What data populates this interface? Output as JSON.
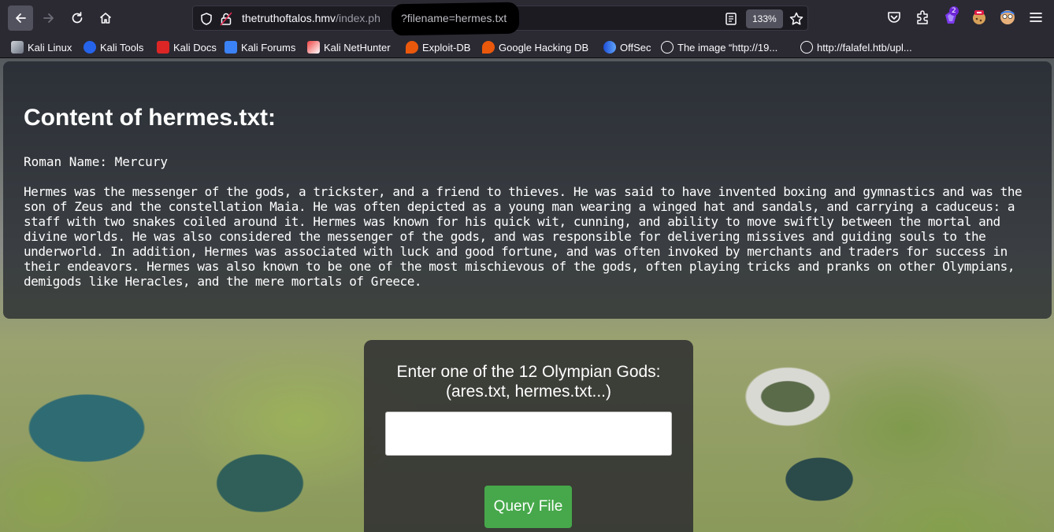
{
  "browser": {
    "url_host": "thetruthoftalos.hmv",
    "url_path": "/index.ph",
    "url_param": "?filename=hermes.txt",
    "zoom": "133%",
    "ext_badge_count": "2"
  },
  "bookmarks": [
    {
      "label": "Kali Linux",
      "icon": "kali-dragon-icon"
    },
    {
      "label": "Kali Tools",
      "icon": "kali-tools-icon"
    },
    {
      "label": "Kali Docs",
      "icon": "kali-docs-icon"
    },
    {
      "label": "Kali Forums",
      "icon": "kali-forums-icon"
    },
    {
      "label": "Kali NetHunter",
      "icon": "nethunter-icon"
    },
    {
      "label": "Exploit-DB",
      "icon": "exploit-db-icon"
    },
    {
      "label": "Google Hacking DB",
      "icon": "ghdb-icon"
    },
    {
      "label": "OffSec",
      "icon": "offsec-icon"
    },
    {
      "label": "The image “http://19...",
      "icon": "globe-icon"
    },
    {
      "label": "http://falafel.htb/upl...",
      "icon": "globe-icon"
    }
  ],
  "content": {
    "title": "Content of hermes.txt:",
    "roman_name": "Roman Name: Mercury",
    "body": "Hermes was the messenger of the gods, a trickster, and a friend to thieves. He was said to have invented boxing and gymnastics and was the son of Zeus and the constellation Maia. He was often depicted as a young man wearing a winged hat and sandals, and carrying a caduceus: a staff with two snakes coiled around it. Hermes was known for his quick wit, cunning, and ability to move swiftly between the mortal and divine worlds. He was also considered the messenger of the gods, and was responsible for delivering missives and guiding souls to the underworld. In addition, Hermes was associated with luck and good fortune, and was often invoked by merchants and traders for success in their endeavors. Hermes was also known to be one of the most mischievous of the gods, often playing tricks and pranks on other Olympians, demigods like Heracles, and the mere mortals of Greece."
  },
  "query": {
    "label_line1": "Enter one of the 12 Olympian Gods:",
    "label_line2": "(ares.txt, hermes.txt...)",
    "input_value": "",
    "button_label": "Query File"
  },
  "colors": {
    "button": "#46a84a",
    "chrome": "#2b2a33"
  }
}
